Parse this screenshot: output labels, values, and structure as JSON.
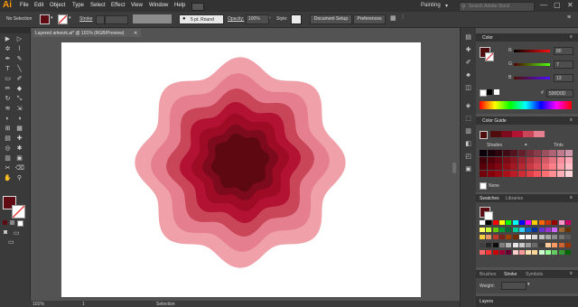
{
  "app": {
    "logo": "Ai"
  },
  "menu": [
    "File",
    "Edit",
    "Object",
    "Type",
    "Select",
    "Effect",
    "View",
    "Window",
    "Help"
  ],
  "workspace": {
    "label": "Painting",
    "chevron": "▾"
  },
  "search": {
    "placeholder": "Search Adobe Stock"
  },
  "window_controls": {
    "minimize": "—",
    "restore": "▢",
    "close": "✕"
  },
  "control_bar": {
    "selection_label": "No Selection",
    "fill_color": "#5e0b14",
    "stroke_label": "Stroke",
    "brush_value": "5 pt. Round",
    "opacity_label": "Opacity:",
    "opacity_value": "100%",
    "style_label": "Style:",
    "doc_setup": "Document Setup",
    "preferences": "Preferences"
  },
  "document": {
    "tab_title": "Layered artwork.ai* @ 101% (RGB/Preview)",
    "close": "✕",
    "zoom": "101%",
    "page": "1",
    "status_tool": "Selection"
  },
  "flower_colors": [
    "#f0a0a8",
    "#e57f8f",
    "#c84657",
    "#b31232",
    "#9e0b25",
    "#7d0a1d",
    "#5e0812"
  ],
  "tools": [
    {
      "glyph": "▶",
      "name": "selection-tool-icon"
    },
    {
      "glyph": "▷",
      "name": "direct-selection-tool-icon"
    },
    {
      "glyph": "✲",
      "name": "magic-wand-tool-icon"
    },
    {
      "glyph": "⌇",
      "name": "lasso-tool-icon"
    },
    {
      "glyph": "✒",
      "name": "pen-tool-icon"
    },
    {
      "glyph": "✎",
      "name": "curvature-tool-icon"
    },
    {
      "glyph": "T",
      "name": "type-tool-icon"
    },
    {
      "glyph": "╲",
      "name": "line-tool-icon"
    },
    {
      "glyph": "▭",
      "name": "rectangle-tool-icon"
    },
    {
      "glyph": "✐",
      "name": "paintbrush-tool-icon"
    },
    {
      "glyph": "✏",
      "name": "pencil-tool-icon"
    },
    {
      "glyph": "◆",
      "name": "shaper-tool-icon"
    },
    {
      "glyph": "↻",
      "name": "rotate-tool-icon"
    },
    {
      "glyph": "⤡",
      "name": "scale-tool-icon"
    },
    {
      "glyph": "≋",
      "name": "warp-tool-icon"
    },
    {
      "glyph": "⇲",
      "name": "free-transform-tool-icon"
    },
    {
      "glyph": "◐",
      "name": "shape-builder-tool-icon"
    },
    {
      "glyph": "◑",
      "name": "live-paint-tool-icon"
    },
    {
      "glyph": "⊞",
      "name": "perspective-grid-tool-icon"
    },
    {
      "glyph": "▦",
      "name": "mesh-tool-icon"
    },
    {
      "glyph": "▤",
      "name": "gradient-tool-icon"
    },
    {
      "glyph": "✚",
      "name": "eyedropper-tool-icon"
    },
    {
      "glyph": "◎",
      "name": "blend-tool-icon"
    },
    {
      "glyph": "✱",
      "name": "symbol-sprayer-tool-icon"
    },
    {
      "glyph": "▥",
      "name": "graph-tool-icon"
    },
    {
      "glyph": "▣",
      "name": "artboard-tool-icon"
    },
    {
      "glyph": "✂",
      "name": "slice-tool-icon"
    },
    {
      "glyph": "⌫",
      "name": "eraser-tool-icon"
    },
    {
      "glyph": "✋",
      "name": "hand-tool-icon"
    },
    {
      "glyph": "⚲",
      "name": "zoom-tool-icon"
    }
  ],
  "color_panel": {
    "title": "Color",
    "r_label": "R",
    "r_value": "80",
    "g_label": "G",
    "g_value": "7",
    "b_label": "B",
    "b_value": "13",
    "hex_label": "#",
    "hex_value": "500D0D",
    "fill_color": "#500d0d"
  },
  "color_guide": {
    "title": "Color Guide",
    "shades_label": "Shades",
    "tints_label": "Tints",
    "none_label": "None"
  },
  "swatches_panel": {
    "tab_swatches": "Swatches",
    "tab_libraries": "Libraries"
  },
  "brushes_panel": {
    "tab_brushes": "Brushes",
    "tab_stroke": "Stroke",
    "tab_symbols": "Symbols",
    "weight_label": "Weight:"
  },
  "layers_panel": {
    "title": "Layers"
  }
}
